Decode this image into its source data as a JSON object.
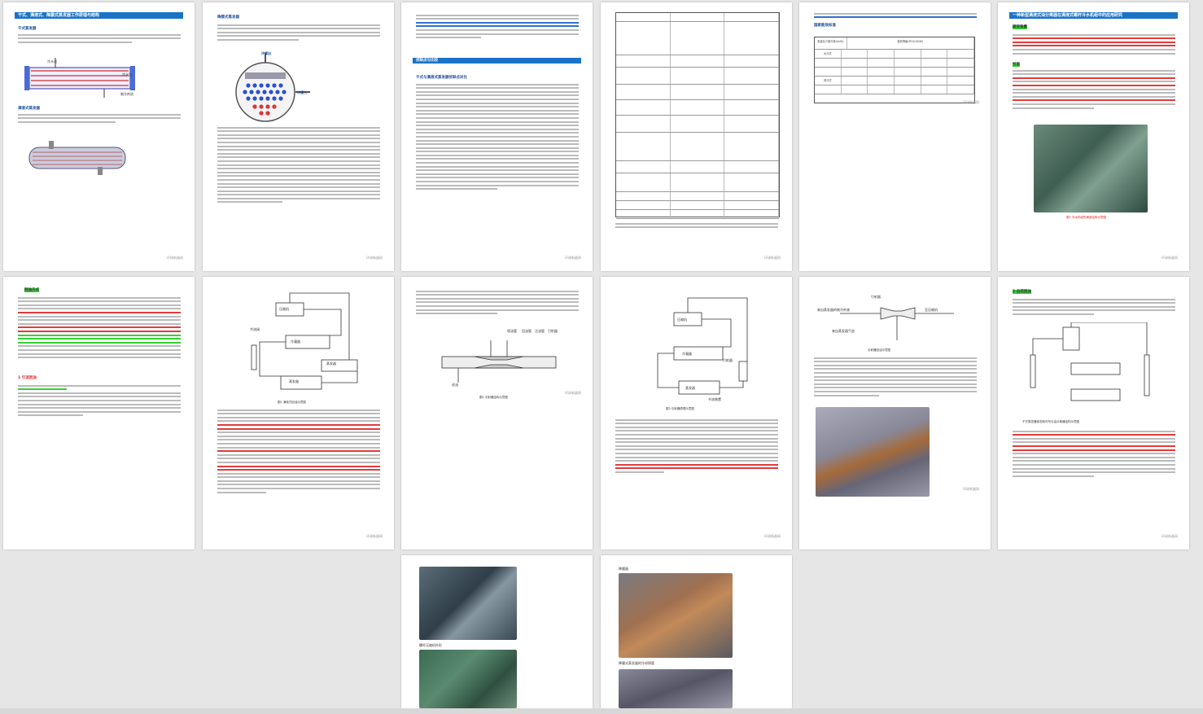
{
  "pages": [
    {
      "id": "p1",
      "header": "干式、满液式、降膜式蒸发器工作原理与结构",
      "sections": [
        "干式蒸发器",
        "满液式蒸发器"
      ],
      "labels": [
        "冷水进",
        "冷水出",
        "制冷剂进"
      ],
      "footer": "环球新器网"
    },
    {
      "id": "p2",
      "header": "",
      "sections": [
        "降膜式蒸发器"
      ],
      "labels": [
        "冷媒出",
        "冷媒入"
      ],
      "footer": "环球新器网"
    },
    {
      "id": "p3",
      "header": "",
      "sections": [
        "优缺点与比较",
        "干式与满液式蒸发器优缺点对比"
      ],
      "labels": [],
      "footer": "环球新器网"
    },
    {
      "id": "p4",
      "header": "",
      "sections": [],
      "labels": [],
      "footer": "环球新器网"
    },
    {
      "id": "p5",
      "header": "",
      "sections": [
        "国家能效标准"
      ],
      "labels": [
        "机组名义制冷量Q(kW)",
        "能效等级(IPLV)(W/W)",
        "水冷式",
        "风冷式"
      ],
      "footer": "环球新器网"
    },
    {
      "id": "p6",
      "header": "一种新型满液式油分离器在满液式螺杆冷水机组中的应用研究",
      "sections": [
        "研究背景",
        "引言"
      ],
      "labels": [
        "图1 冷水机组的满液结构示意图"
      ],
      "footer": "环球新器网"
    },
    {
      "id": "p7",
      "header": "",
      "sections": [
        "回油方式",
        "1 引流回油"
      ],
      "labels": [],
      "footer": ""
    },
    {
      "id": "p8",
      "header": "",
      "sections": [],
      "labels": [
        "压缩机",
        "冷凝器",
        "节流阀",
        "蒸发器",
        "蒸发器",
        "油分离器",
        "图1 满液式回油示意图"
      ],
      "footer": "环球新器网"
    },
    {
      "id": "p9",
      "header": "",
      "sections": [],
      "labels": [
        "喷油管",
        "回油管",
        "注油管",
        "引射器",
        "进油",
        "图2 引射器结构示意图"
      ],
      "footer": "环球新器网"
    },
    {
      "id": "p10",
      "header": "",
      "sections": [],
      "labels": [
        "压缩机",
        "冷凝器",
        "蒸发器",
        "节流装置",
        "引射器",
        "图3 引射器原理示意图"
      ],
      "footer": "环球新器网"
    },
    {
      "id": "p11",
      "header": "",
      "sections": [],
      "labels": [
        "引射器",
        "来自蒸发器的制冷剂液",
        "来自蒸发器气态",
        "至压缩机",
        "引射器回油示意图"
      ],
      "footer": "环球新器网"
    },
    {
      "id": "p12",
      "header": "",
      "sections": [
        "2 自然回油"
      ],
      "labels": [
        "干式蒸发器液态制冷剂与油分离器结构示意图"
      ],
      "footer": "环球新器网"
    },
    {
      "id": "p13",
      "header": "",
      "sections": [],
      "labels": [
        "螺杆压缩机外形",
        "螺杆压缩机外形"
      ],
      "footer": ""
    },
    {
      "id": "p14",
      "header": "",
      "sections": [
        "降膜器"
      ],
      "labels": [
        "降膜式蒸发器的冷却铜管"
      ],
      "footer": ""
    }
  ]
}
